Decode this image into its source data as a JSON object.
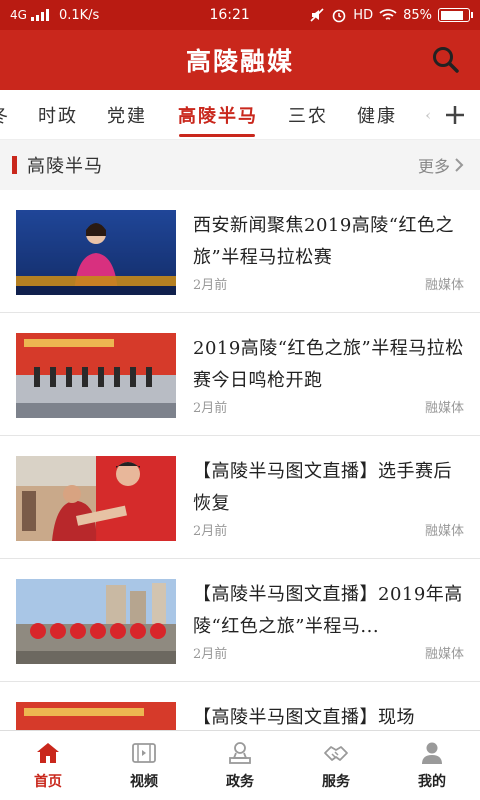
{
  "status_bar": {
    "network": "4G",
    "speed": "0.1K/s",
    "time": "16:21",
    "hd": "HD",
    "battery": "85%",
    "battery_level": 0.85
  },
  "header": {
    "title": "高陵融媒",
    "search_icon": "search-icon"
  },
  "tabs": {
    "items": [
      "冬",
      "时政",
      "党建",
      "高陵半马",
      "三农",
      "健康",
      "‹"
    ],
    "active": "高陵半马",
    "add_icon": "plus-icon"
  },
  "section": {
    "title": "高陵半马",
    "more_label": "更多",
    "more_icon": "chevron-right-icon"
  },
  "articles": [
    {
      "title": "西安新闻聚焦2019高陵“红色之旅”半程马拉松赛",
      "time": "2月前",
      "source": "融媒体"
    },
    {
      "title": "2019高陵“红色之旅”半程马拉松赛今日鸣枪开跑",
      "time": "2月前",
      "source": "融媒体"
    },
    {
      "title": "【高陵半马图文直播】选手赛后恢复",
      "time": "2月前",
      "source": "融媒体"
    },
    {
      "title": "【高陵半马图文直播】2019年高陵“红色之旅”半程马...",
      "time": "2月前",
      "source": "融媒体"
    },
    {
      "title": "【高陵半马图文直播】现场",
      "time": "",
      "source": ""
    }
  ],
  "bottom_nav": [
    {
      "label": "首页",
      "icon": "home-icon"
    },
    {
      "label": "视频",
      "icon": "video-icon"
    },
    {
      "label": "政务",
      "icon": "government-icon"
    },
    {
      "label": "服务",
      "icon": "handshake-icon"
    },
    {
      "label": "我的",
      "icon": "user-icon"
    }
  ],
  "colors": {
    "brand": "#c9271c",
    "status_bar": "#b91b12"
  }
}
